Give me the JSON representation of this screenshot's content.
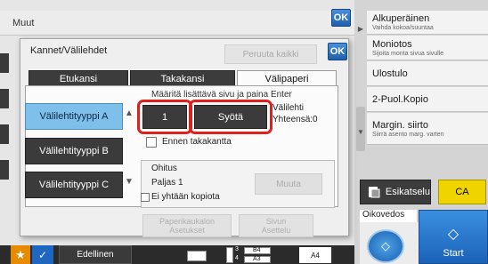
{
  "background": {
    "title": "Muut",
    "ok_label": "OK"
  },
  "right_menu": {
    "items": [
      {
        "label": "Alkuperäinen",
        "sub": "Vaihda kokoa/suuntaa"
      },
      {
        "label": "Moniotos",
        "sub": "Sijoita monta sivua sivulle"
      },
      {
        "label": "Ulostulo",
        "sub": ""
      },
      {
        "label": "2-Puol.Kopio",
        "sub": ""
      },
      {
        "label": "Margin. siirto",
        "sub": "Siirrä asento marg. varten"
      }
    ],
    "preview_label": "Esikatselu",
    "ca_label": "CA",
    "proof_label": "Oikovedos",
    "start_label": "Start"
  },
  "bottom": {
    "prev_label": "Edellinen",
    "size_b4": "B4",
    "size_a3": "A3",
    "num_3": "3",
    "num_4": "4",
    "size_a4": "A4"
  },
  "dialog": {
    "title": "Kannet/Välilehdet",
    "cancel_all": "Peruuta kaikki",
    "ok_label": "OK",
    "tabs": [
      "Etukansi",
      "Takakansi",
      "Välipaperi"
    ],
    "active_tab": "Välipaperi",
    "types": [
      "Välilehtityyppi A",
      "Välilehtityyppi B",
      "Välilehtityyppi C"
    ],
    "active_type": "Välilehtityyppi A",
    "info_text": "Määritä lisättävä sivu ja paina Enter",
    "page_value": "1",
    "enter_label": "Syötä",
    "tab_count_label": "Välilehti",
    "total_label": "Yhteensä:0",
    "before_back_cover": "Ennen takakantta",
    "skip_label": "Ohitus",
    "blank_label": "Paljas 1",
    "no_copy_label": "Ei yhtään kopiota",
    "change_label": "Muuta",
    "paper_tray_label": [
      "Paperikaukalon",
      "Asetukset"
    ],
    "page_setting_label": [
      "Sivun",
      "Asettelu"
    ]
  }
}
